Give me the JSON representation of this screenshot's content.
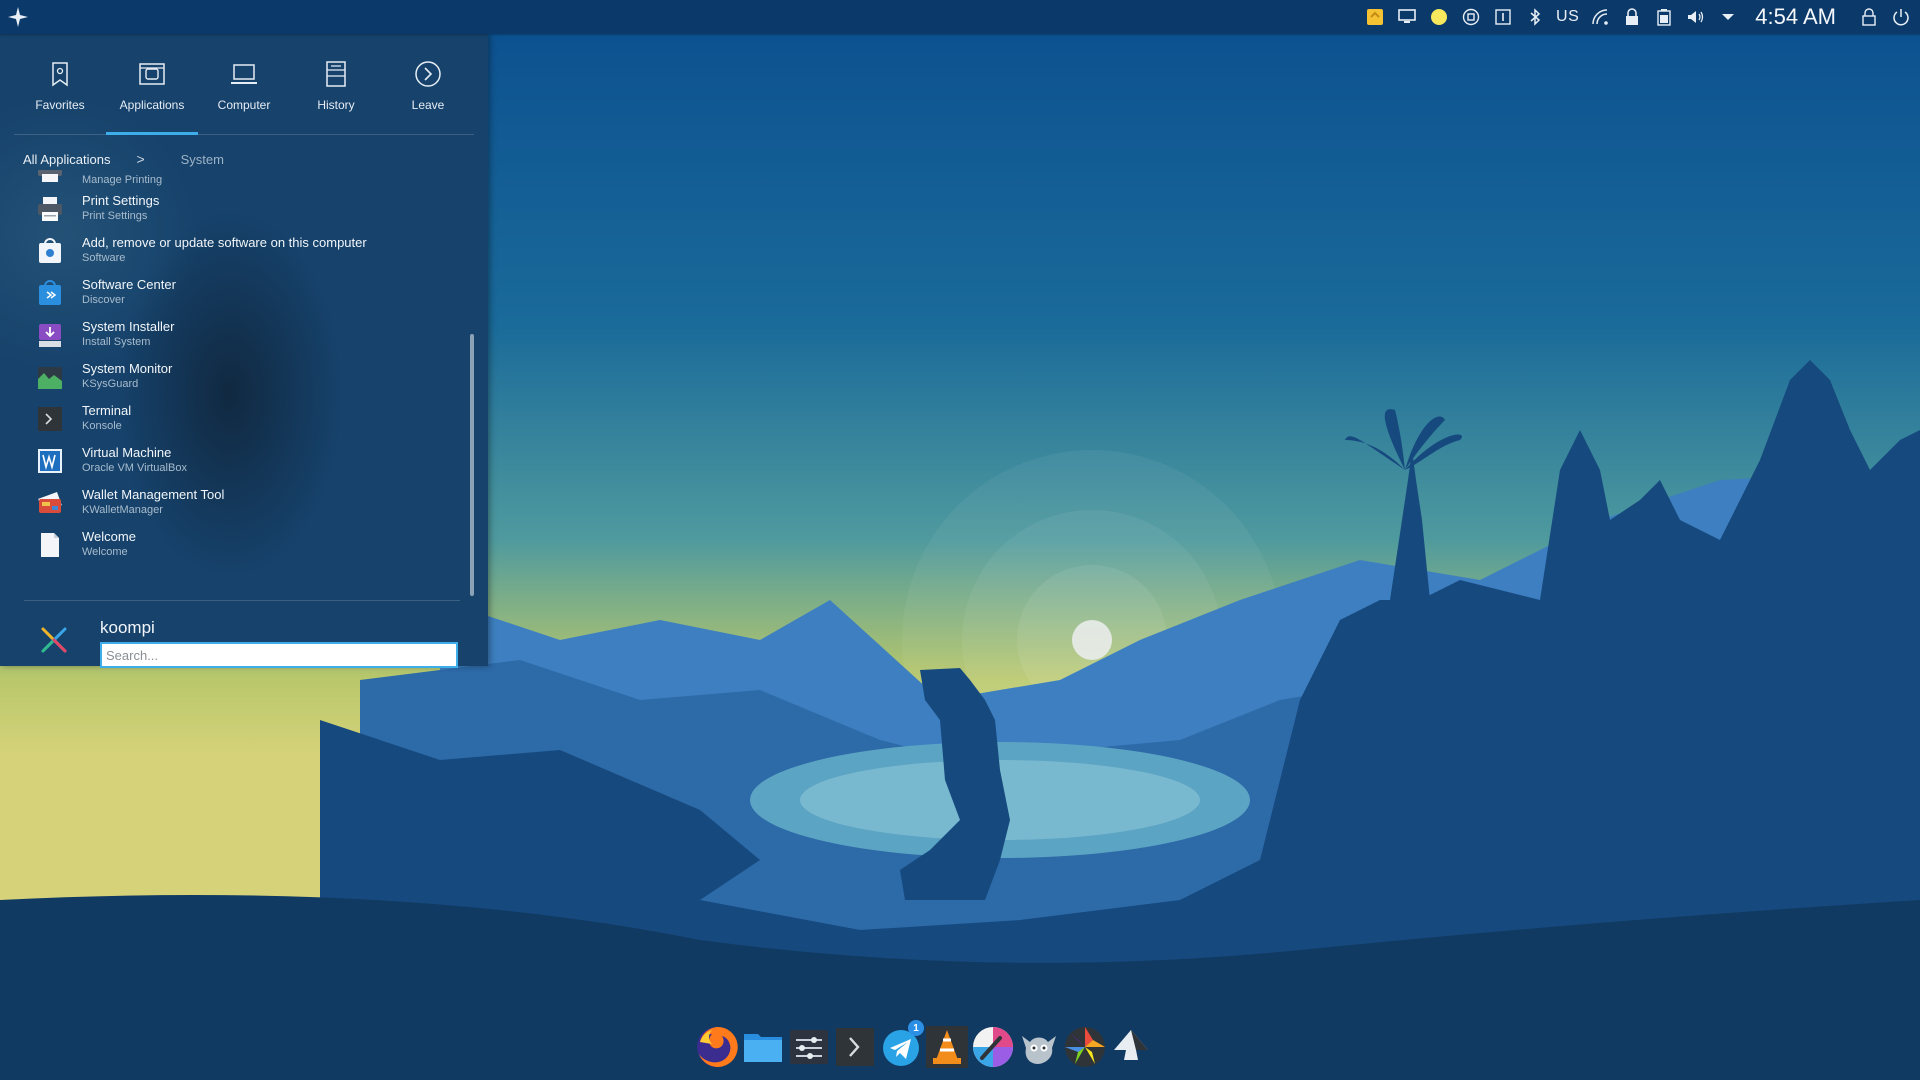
{
  "clock": "4:54 AM",
  "keyboard_layout": "US",
  "menu": {
    "tabs": [
      {
        "label": "Favorites",
        "icon": "bookmark-icon"
      },
      {
        "label": "Applications",
        "icon": "applications-icon",
        "active": true
      },
      {
        "label": "Computer",
        "icon": "laptop-icon"
      },
      {
        "label": "History",
        "icon": "history-icon"
      },
      {
        "label": "Leave",
        "icon": "leave-icon"
      }
    ],
    "breadcrumb": {
      "root": "All Applications",
      "separator": ">",
      "current": "System"
    },
    "apps": [
      {
        "name": "",
        "desc": "Manage Printing",
        "icon": "printer-icon"
      },
      {
        "name": "Print Settings",
        "desc": "Print Settings",
        "icon": "printer-icon"
      },
      {
        "name": "Add, remove or update software on this computer",
        "desc": "Software",
        "icon": "software-bag-icon"
      },
      {
        "name": "Software Center",
        "desc": "Discover",
        "icon": "discover-icon"
      },
      {
        "name": "System Installer",
        "desc": "Install System",
        "icon": "installer-icon"
      },
      {
        "name": "System Monitor",
        "desc": "KSysGuard",
        "icon": "system-monitor-icon"
      },
      {
        "name": "Terminal",
        "desc": "Konsole",
        "icon": "terminal-icon"
      },
      {
        "name": "Virtual Machine",
        "desc": "Oracle VM VirtualBox",
        "icon": "virtualbox-icon"
      },
      {
        "name": "Wallet Management Tool",
        "desc": "KWalletManager",
        "icon": "wallet-icon"
      },
      {
        "name": "Welcome",
        "desc": "Welcome",
        "icon": "welcome-icon"
      }
    ],
    "user": "koompi",
    "search_placeholder": "Search..."
  },
  "tray_icons": [
    "notes-icon",
    "display-icon",
    "night-color-icon",
    "media-icon",
    "clipboard-icon",
    "bluetooth-icon",
    "network-icon",
    "lock-icon",
    "battery-icon",
    "volume-icon",
    "expand-icon",
    "lock-screen-icon",
    "power-icon"
  ],
  "dock_items": [
    {
      "name": "firefox-icon"
    },
    {
      "name": "file-manager-icon"
    },
    {
      "name": "settings-icon"
    },
    {
      "name": "terminal-icon"
    },
    {
      "name": "telegram-icon",
      "badge": "1"
    },
    {
      "name": "vlc-icon"
    },
    {
      "name": "color-picker-icon"
    },
    {
      "name": "gimp-icon"
    },
    {
      "name": "aperture-icon"
    },
    {
      "name": "inkscape-icon"
    }
  ],
  "colors": {
    "accent": "#3daee9",
    "panel": "#0b3a6a",
    "menu_bg": "#16426b"
  }
}
